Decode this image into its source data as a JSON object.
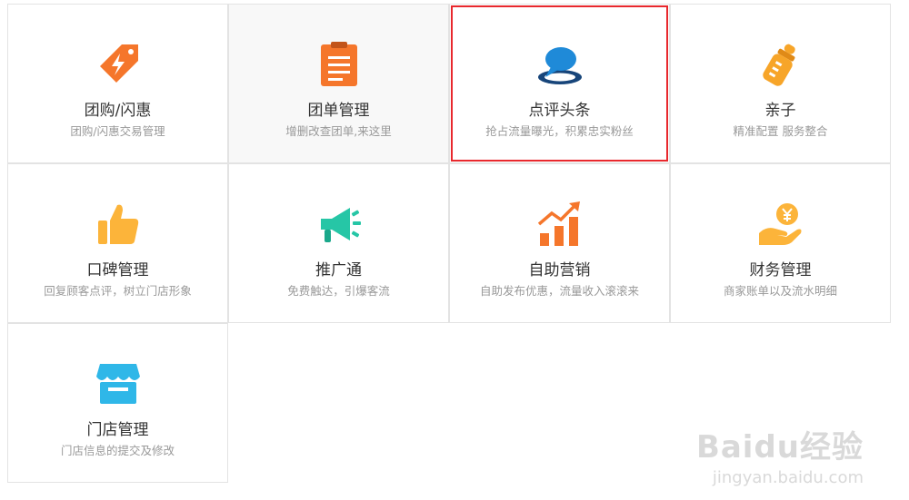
{
  "tiles": [
    {
      "title": "团购/闪惠",
      "desc": "团购/闪惠交易管理",
      "icon": "lightning-tag-icon",
      "color": "#f5762b"
    },
    {
      "title": "团单管理",
      "desc": "增删改查团单,来这里",
      "icon": "clipboard-icon",
      "color": "#f5762b"
    },
    {
      "title": "点评头条",
      "desc": "抢占流量曝光，积累忠实粉丝",
      "icon": "speech-bubble-icon",
      "color": "#1f8ad8"
    },
    {
      "title": "亲子",
      "desc": "精准配置 服务整合",
      "icon": "baby-bottle-icon",
      "color": "#f7a529"
    },
    {
      "title": "口碑管理",
      "desc": "回复顾客点评，树立门店形象",
      "icon": "thumbs-up-icon",
      "color": "#fcb43a"
    },
    {
      "title": "推广通",
      "desc": "免费触达，引爆客流",
      "icon": "megaphone-icon",
      "color": "#26c6a6"
    },
    {
      "title": "自助营销",
      "desc": "自助发布优惠，流量收入滚滚来",
      "icon": "growth-chart-icon",
      "color": "#f5762b"
    },
    {
      "title": "财务管理",
      "desc": "商家账单以及流水明细",
      "icon": "coin-hand-icon",
      "color": "#fcb43a"
    },
    {
      "title": "门店管理",
      "desc": "门店信息的提交及修改",
      "icon": "storefront-icon",
      "color": "#2fb7e8"
    }
  ],
  "watermark": {
    "logo": "Baidu经验",
    "url": "jingyan.baidu.com"
  }
}
